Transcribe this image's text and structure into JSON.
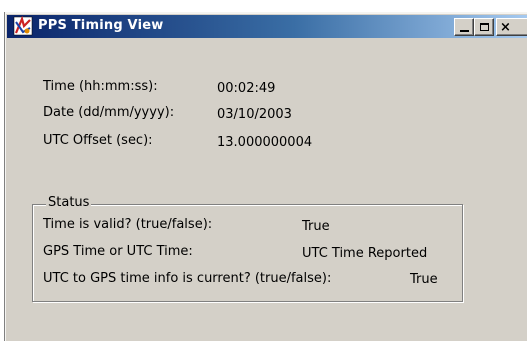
{
  "window": {
    "title": "PPS Timing View",
    "buttons": {
      "close_label": "×"
    }
  },
  "fields": [
    {
      "label": "Time (hh:mm:ss):",
      "value": "00:02:49"
    },
    {
      "label": "Date (dd/mm/yyyy):",
      "value": "03/10/2003"
    },
    {
      "label": "UTC Offset (sec):",
      "value": "13.000000004"
    }
  ],
  "status": {
    "legend": "Status",
    "rows": [
      {
        "label": "Time is valid? (true/false):",
        "value": "True"
      },
      {
        "label": "GPS Time or UTC Time:",
        "value": "UTC Time Reported"
      },
      {
        "label": "UTC to GPS time info is current? (true/false):",
        "value": "True"
      }
    ]
  }
}
